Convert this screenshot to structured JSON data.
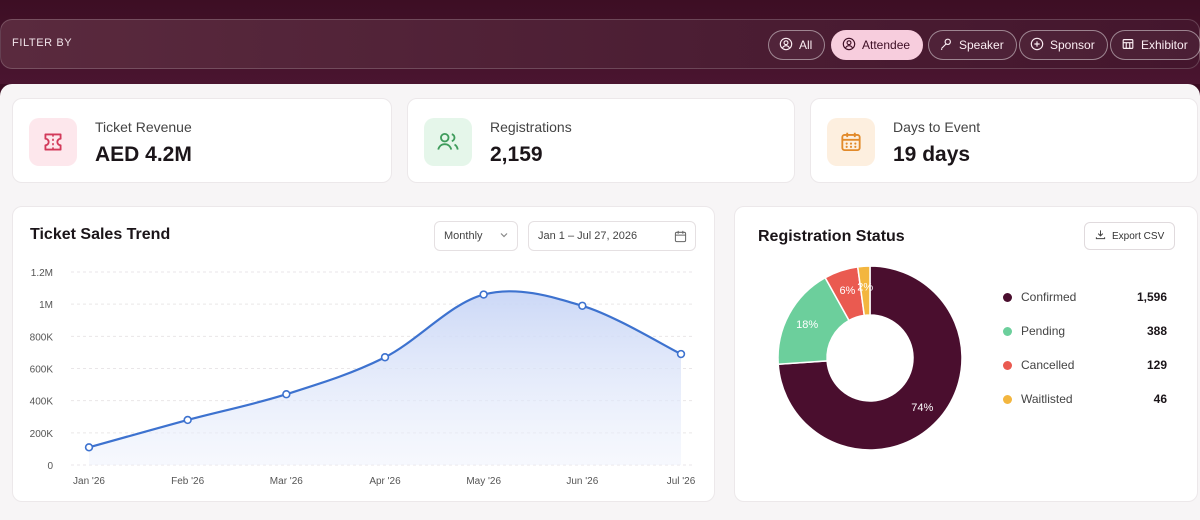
{
  "filter": {
    "label": "FILTER BY",
    "chips": [
      {
        "label": "All",
        "icon": "user-circle-icon",
        "active": false
      },
      {
        "label": "Attendee",
        "icon": "user-circle-icon",
        "active": true
      },
      {
        "label": "Speaker",
        "icon": "microphone-icon",
        "active": false
      },
      {
        "label": "Sponsor",
        "icon": "plus-circle-icon",
        "active": false
      },
      {
        "label": "Exhibitor",
        "icon": "booth-icon",
        "active": false
      }
    ]
  },
  "kpis": [
    {
      "label": "Ticket Revenue",
      "value": "AED 4.2M",
      "icon": "ticket-icon",
      "color": "#d23a5a"
    },
    {
      "label": "Registrations",
      "value": "2,159",
      "icon": "users-icon",
      "color": "#3f9c5c"
    },
    {
      "label": "Days to Event",
      "value": "19 days",
      "icon": "calendar-icon",
      "color": "#e28a2a"
    }
  ],
  "trend": {
    "title": "Ticket Sales Trend",
    "period_select": "Monthly",
    "date_range": "Jan 1 – Jul 27, 2026"
  },
  "status": {
    "title": "Registration Status",
    "export_label": "Export CSV"
  },
  "colors": {
    "line": "#3d72cf",
    "confirmed": "#4a0e2e",
    "pending": "#6ccf9c",
    "cancelled": "#ea5a50",
    "waitlisted": "#f3b63f"
  },
  "chart_data": [
    {
      "type": "area",
      "title": "Ticket Sales Trend",
      "categories": [
        "Jan '26",
        "Feb '26",
        "Mar '26",
        "Apr '26",
        "May '26",
        "Jun '26",
        "Jul '26"
      ],
      "values": [
        110000,
        280000,
        440000,
        670000,
        1060000,
        990000,
        690000
      ],
      "ylim": [
        0,
        1200000
      ],
      "yticks": [
        "0",
        "200K",
        "400K",
        "600K",
        "800K",
        "1M",
        "1.2M"
      ],
      "grid": true
    },
    {
      "type": "pie",
      "title": "Registration Status",
      "series": [
        {
          "name": "Confirmed",
          "value": 1596,
          "label": "74%"
        },
        {
          "name": "Pending",
          "value": 388,
          "label": "18%"
        },
        {
          "name": "Cancelled",
          "value": 129,
          "label": "6%"
        },
        {
          "name": "Waitlisted",
          "value": 46,
          "label": "2%"
        }
      ],
      "legend": "right"
    }
  ]
}
